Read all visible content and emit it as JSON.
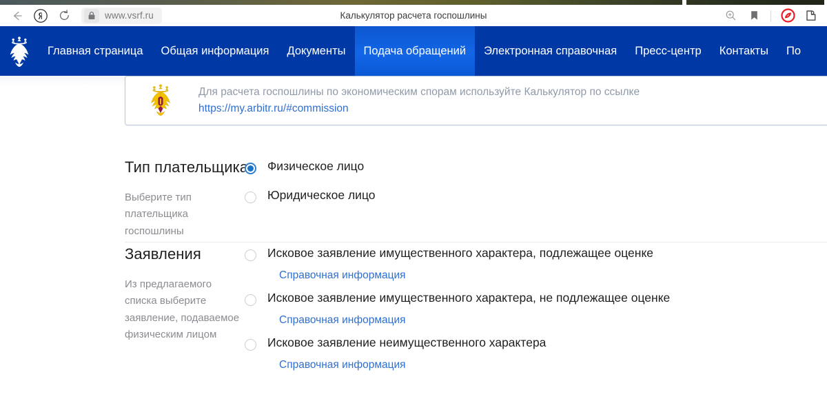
{
  "browser": {
    "tab_title": "Калькулятор расчета госпошлины",
    "url": "www.vsrf.ru",
    "back_icon": "back-arrow-icon",
    "yandex_icon": "yandex-logo-icon",
    "reload_icon": "reload-icon",
    "lock_icon": "lock-icon",
    "zoom_icon": "zoom-in-icon",
    "bookmark_icon": "bookmark-icon",
    "adblock_icon": "adblock-icon",
    "extensions_icon": "extensions-icon"
  },
  "sitenav": {
    "emblem_icon": "russian-coat-of-arms-icon",
    "accent_color": "#0039a6",
    "active_color": "#1266e6",
    "items": [
      {
        "label": "Главная страница",
        "active": false
      },
      {
        "label": "Общая информация",
        "active": false
      },
      {
        "label": "Документы",
        "active": false
      },
      {
        "label": "Подача обращений",
        "active": true
      },
      {
        "label": "Электронная справочная",
        "active": false
      },
      {
        "label": "Пресс-центр",
        "active": false
      },
      {
        "label": "Контакты",
        "active": false
      },
      {
        "label": "По",
        "active": false
      }
    ]
  },
  "banner": {
    "emblem_icon": "russian-coat-of-arms-gold-icon",
    "text": "Для расчета госпошлины по экономическим спорам используйте Калькулятор по ссылке",
    "link": "https://my.arbitr.ru/#commission",
    "border_color": "#b9c7de",
    "link_color": "#2f6fd0"
  },
  "payer_section": {
    "title": "Тип плательщика",
    "description": "Выберите тип плательщика госпошлины",
    "options": [
      {
        "label": "Физическое лицо",
        "checked": true
      },
      {
        "label": "Юридическое лицо",
        "checked": false
      }
    ]
  },
  "applications_section": {
    "title": "Заявления",
    "description": "Из предлагаемого списка выберите заявление, подаваемое физическим лицом",
    "help_label": "Справочная информация",
    "options": [
      {
        "label": "Исковое заявление имущественного характера, подлежащее оценке",
        "checked": false,
        "help": "Справочная информация"
      },
      {
        "label": "Исковое заявление имущественного характера, не подлежащее оценке",
        "checked": false,
        "help": "Справочная информация"
      },
      {
        "label": "Исковое заявление неимущественного характера",
        "checked": false,
        "help": "Справочная информация"
      }
    ]
  }
}
